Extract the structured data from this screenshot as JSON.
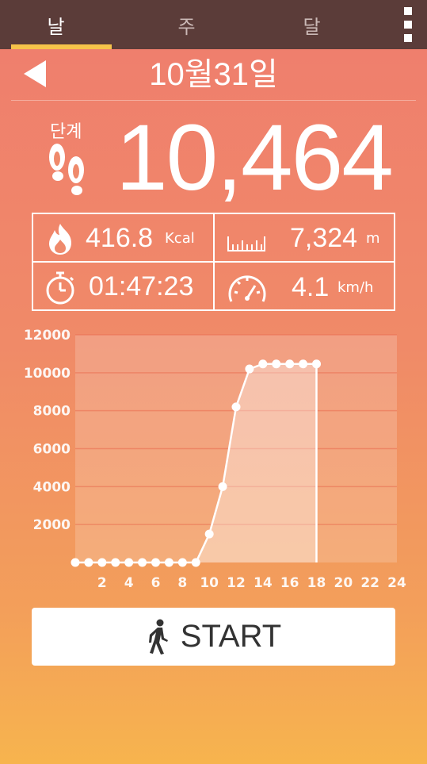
{
  "tabs": [
    {
      "label": "날",
      "active": true
    },
    {
      "label": "주",
      "active": false
    },
    {
      "label": "달",
      "active": false
    }
  ],
  "header": {
    "date": "10월31일"
  },
  "steps": {
    "label": "단계",
    "value": "10,464"
  },
  "stats": {
    "calories": {
      "value": "416.8",
      "unit": "Kcal",
      "icon": "fire-icon"
    },
    "distance": {
      "value": "7,324",
      "unit": "m",
      "icon": "ruler-icon"
    },
    "duration": {
      "value": "01:47:23",
      "icon": "stopwatch-icon"
    },
    "speed": {
      "value": "4.1",
      "unit": "km/h",
      "icon": "speedometer-icon"
    }
  },
  "colors": {
    "topbar": "#5b3c39",
    "accent": "#f6c34a"
  },
  "chart_data": {
    "type": "area",
    "x": [
      0,
      1,
      2,
      3,
      4,
      5,
      6,
      7,
      8,
      9,
      10,
      11,
      12,
      13,
      14,
      15,
      16,
      17,
      18
    ],
    "y": [
      0,
      0,
      0,
      0,
      0,
      0,
      0,
      0,
      0,
      0,
      1500,
      4000,
      8200,
      10200,
      10464,
      10464,
      10464,
      10464,
      10464
    ],
    "xlim": [
      0,
      24
    ],
    "ylim": [
      0,
      12000
    ],
    "x_ticks": [
      2,
      4,
      6,
      8,
      10,
      12,
      14,
      16,
      18,
      20,
      22,
      24
    ],
    "y_ticks": [
      2000,
      4000,
      6000,
      8000,
      10000,
      12000
    ],
    "grid": true
  },
  "start_button": {
    "label": "START",
    "icon": "walking-person-icon"
  }
}
